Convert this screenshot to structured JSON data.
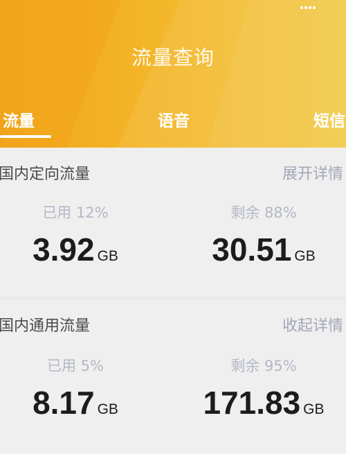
{
  "header": {
    "title": "流量查询",
    "colors": {
      "gradient_start": "#f2a51b",
      "gradient_end": "#f1c73e"
    }
  },
  "tabs": [
    {
      "label": "流量",
      "active": true
    },
    {
      "label": "语音",
      "active": false
    },
    {
      "label": "短信",
      "active": false
    }
  ],
  "sections": [
    {
      "title": "国内定向流量",
      "action": "展开详情",
      "used": {
        "label": "已用 12%",
        "value": "3.92",
        "unit": "GB"
      },
      "remaining": {
        "label": "剩余 88%",
        "value": "30.51",
        "unit": "GB"
      }
    },
    {
      "title": "国内通用流量",
      "action": "收起详情",
      "used": {
        "label": "已用 5%",
        "value": "8.17",
        "unit": "GB"
      },
      "remaining": {
        "label": "剩余 95%",
        "value": "171.83",
        "unit": "GB"
      }
    }
  ]
}
